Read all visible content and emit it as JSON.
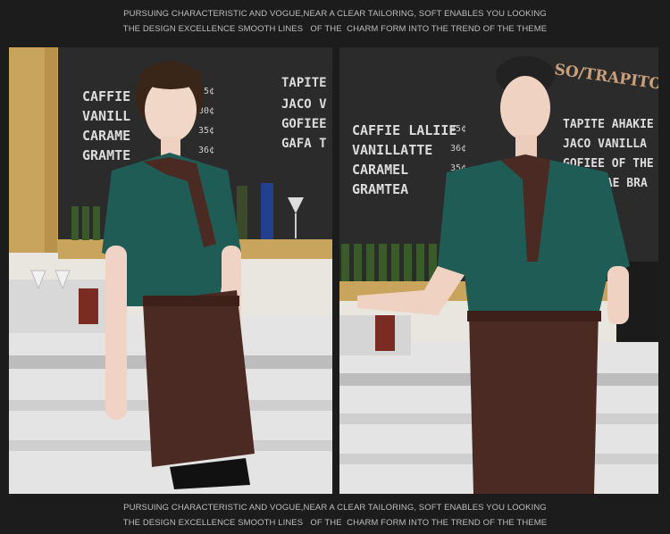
{
  "captions": {
    "top": {
      "line1": "PURSUING CHARACTERISTIC AND VOGUE,NEAR A CLEAR TAILORING, SOFT ENABLES YOU LOOKING",
      "line2": "THE DESIGN EXCELLENCE SMOOTH LINES   OF THE  CHARM FORM INTO THE TREND OF THE THEME"
    },
    "bottom": {
      "line1": "PURSUING CHARACTERISTIC AND VOGUE,NEAR A CLEAR TAILORING, SOFT ENABLES YOU LOOKING",
      "line2": "THE DESIGN EXCELLENCE SMOOTH LINES   OF THE  CHARM FORM INTO THE TREND OF THE THEME"
    }
  },
  "left_photo": {
    "menu_left": [
      "CAFFIE",
      "VANILL",
      "CARAME",
      "GRAMTE"
    ],
    "menu_right": [
      "TAPITE",
      "JACO V",
      "GOFIEE",
      "GAFA T"
    ],
    "prices": [
      "35¢",
      "30¢",
      "35¢",
      "36¢"
    ]
  },
  "right_photo": {
    "sign": "SO/TRAPITO",
    "menu_left": [
      "CAFFIE LALIIE",
      "VANILLATTE",
      "CARAMEL",
      "GRAMTEA"
    ],
    "prices": [
      "35¢",
      "36¢",
      "35¢"
    ],
    "menu_right": [
      "TAPITE AHAKIE",
      "JACO VANILLA",
      "GOFIEE OF THE",
      "TAE BRA"
    ]
  },
  "colors": {
    "background": "#1c1c1c",
    "caption_text": "#bdbdbd",
    "chalkboard": "#2b2b2b",
    "shirt_teal": "#1f5c55",
    "apron_brown": "#4a2a22",
    "counter_white": "#ececec",
    "wood": "#c9a45c"
  }
}
